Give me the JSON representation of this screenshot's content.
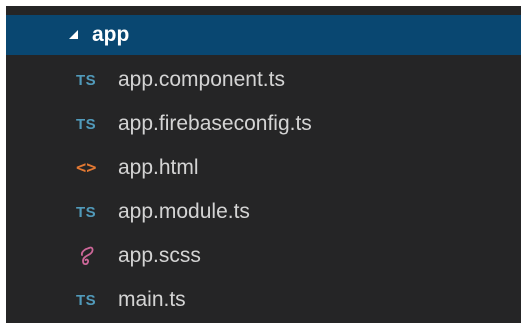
{
  "explorer": {
    "folder": {
      "name": "app",
      "icon": "chevron-expanded-icon",
      "expanded": true,
      "selected": true
    },
    "files": [
      {
        "name": "app.component.ts",
        "icon": "typescript-icon",
        "icon_text": "TS"
      },
      {
        "name": "app.firebaseconfig.ts",
        "icon": "typescript-icon",
        "icon_text": "TS"
      },
      {
        "name": "app.html",
        "icon": "html-icon",
        "icon_text": "<>"
      },
      {
        "name": "app.module.ts",
        "icon": "typescript-icon",
        "icon_text": "TS"
      },
      {
        "name": "app.scss",
        "icon": "sass-icon"
      },
      {
        "name": "main.ts",
        "icon": "typescript-icon",
        "icon_text": "TS"
      }
    ]
  },
  "colors": {
    "panel_background": "#252526",
    "selection": "#094771",
    "text": "#d4d4d4",
    "typescript": "#519aba",
    "html": "#e37933",
    "sass": "#cd6799"
  }
}
